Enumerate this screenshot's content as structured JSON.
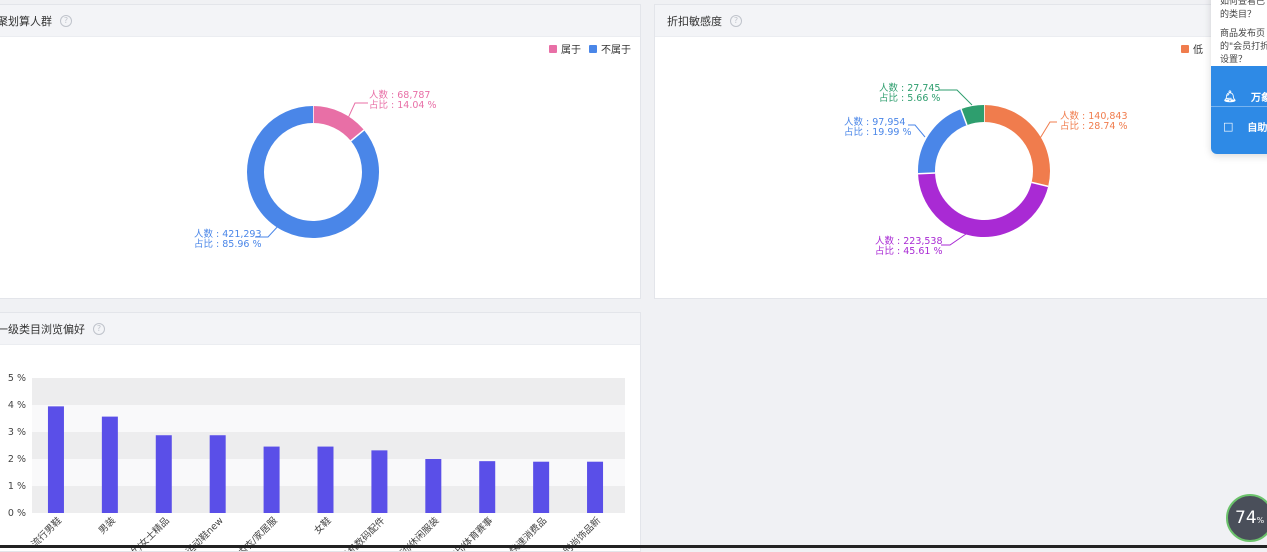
{
  "panels": {
    "crowd": {
      "title": "聚划算人群",
      "legend": [
        {
          "label": "属于",
          "color": "#e86fa6"
        },
        {
          "label": "不属于",
          "color": "#4a86e8"
        }
      ],
      "labels": [
        {
          "line1": "人数 : 68,787",
          "line2": "占比 : 14.04 %",
          "color": "#e86fa6"
        },
        {
          "line1": "人数 : 421,293",
          "line2": "占比 : 85.96 %",
          "color": "#4a86e8"
        }
      ]
    },
    "discount": {
      "title": "折扣敏感度",
      "legend": [
        {
          "label": "低",
          "color": "#f07c4d"
        }
      ],
      "labels": [
        {
          "line1": "人数 : 27,745",
          "line2": "占比 : 5.66 %",
          "color": "#2e9e6e"
        },
        {
          "line1": "人数 : 97,954",
          "line2": "占比 : 19.99 %",
          "color": "#4a86e8"
        },
        {
          "line1": "人数 : 140,843",
          "line2": "占比 : 28.74 %",
          "color": "#f07c4d"
        },
        {
          "line1": "人数 : 223,538",
          "line2": "占比 : 45.61 %",
          "color": "#a92ad4"
        }
      ]
    },
    "category": {
      "title": "一级类目浏览偏好"
    }
  },
  "chart_data": [
    {
      "type": "pie",
      "donut": true,
      "title": "聚划算人群",
      "series": [
        {
          "name": "属于",
          "count": 68787,
          "percent": 14.04,
          "color": "#e86fa6"
        },
        {
          "name": "不属于",
          "count": 421293,
          "percent": 85.96,
          "color": "#4a86e8"
        }
      ],
      "legend": "top-right"
    },
    {
      "type": "pie",
      "donut": true,
      "title": "折扣敏感度",
      "series": [
        {
          "count": 140843,
          "percent": 28.74,
          "color": "#f07c4d"
        },
        {
          "count": 223538,
          "percent": 45.61,
          "color": "#a92ad4"
        },
        {
          "count": 97954,
          "percent": 19.99,
          "color": "#4a86e8"
        },
        {
          "count": 27745,
          "percent": 5.66,
          "color": "#2e9e6e"
        }
      ],
      "legend": "top-right"
    },
    {
      "type": "bar",
      "title": "一级类目浏览偏好",
      "categories": [
        "流行男鞋",
        "男装",
        "女/女士精品",
        "运动鞋new",
        "内衣/家居服",
        "女鞋",
        "手机数码配件",
        "运动/休闲服装",
        "电影/演出/体育赛事",
        "快速消费品",
        "服饰配件/皮带/帽子/围巾/时尚饰品新"
      ],
      "category_labels": [
        "流行男鞋",
        "男装",
        "女/女士精品",
        "运动鞋new",
        "内衣/家居服",
        "女鞋",
        "手机数码配件",
        "运动/休闲服装",
        "出/体育赛事",
        "快速消费品",
        "时尚饰品新"
      ],
      "values": [
        3.95,
        3.57,
        2.88,
        2.88,
        2.46,
        2.46,
        2.32,
        2.0,
        1.92,
        1.9,
        1.9
      ],
      "yticks": [
        "0 %",
        "1 %",
        "2 %",
        "3 %",
        "4 %",
        "5 %"
      ],
      "ylim": [
        0,
        5
      ],
      "bar_color": "#5a4fe8",
      "grid": true
    }
  ],
  "help_widget": {
    "faq_lines": [
      "如何查看已",
      "的类目？",
      "商品发布页",
      "的\"会员打折",
      "设置？"
    ],
    "row1_label": "万象",
    "row2_label": "自助"
  },
  "progress": {
    "value": "74",
    "unit": "%"
  }
}
